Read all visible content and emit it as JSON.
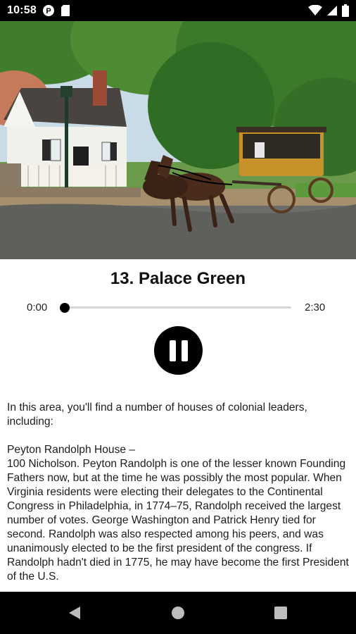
{
  "status_bar": {
    "time": "10:58",
    "left_icons": [
      "notification-icon",
      "sd-card-icon"
    ],
    "right_icons": [
      "wifi-icon",
      "cellular-signal-icon",
      "battery-icon"
    ]
  },
  "hero_image": {
    "description_icon": "horse-carriage-photo"
  },
  "player": {
    "title": "13. Palace Green",
    "time_elapsed": "0:00",
    "time_total": "2:30",
    "progress": 0.0,
    "state_icon": "pause-icon"
  },
  "description": {
    "paragraphs": [
      "In this area, you'll find a number of houses of colonial leaders, including:",
      "Peyton Randolph House –\n100 Nicholson. Peyton Randolph is one of the lesser known Founding Fathers now, but at the time he was possibly the most popular. When Virginia residents were electing their delegates to the Continental Congress in Philadelphia, in 1774–75, Randolph received the largest number of votes. George Washington and Patrick Henry tied for second. Randolph was also respected among his peers, and was unanimously elected to be the first president of the congress. If Randolph hadn't died in 1775, he may have become the first President of the U.S."
    ]
  },
  "nav_bar": {
    "icons": [
      "back-icon",
      "home-icon",
      "recents-icon"
    ]
  },
  "colors": {
    "background": "#ffffff",
    "bars": "#000000",
    "text": "#111111",
    "seek_track": "#d5d5d5"
  }
}
